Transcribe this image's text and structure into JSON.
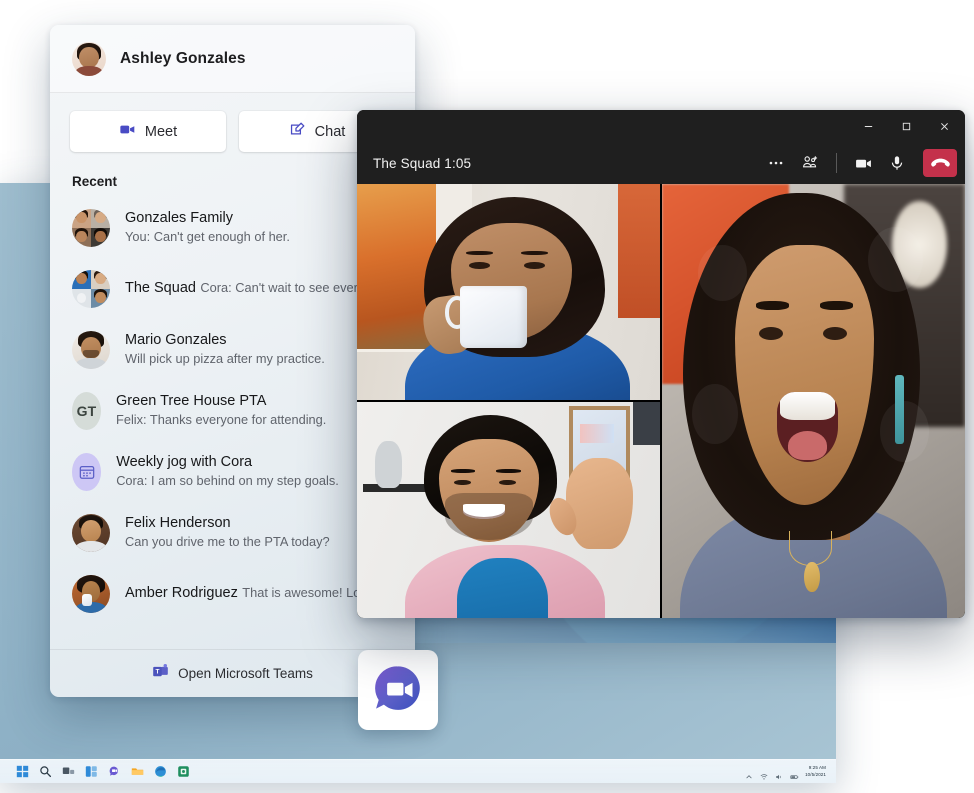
{
  "flyout": {
    "user": {
      "name": "Ashley Gonzales",
      "avatar_icon": "user-avatar-ashley"
    },
    "actions": [
      {
        "id": "meet",
        "label": "Meet",
        "icon": "video-camera-icon"
      },
      {
        "id": "chat",
        "label": "Chat",
        "icon": "compose-chat-icon"
      }
    ],
    "section_title": "Recent",
    "recent": [
      {
        "title": "Gonzales Family",
        "preview": "You: Can't get enough of her.",
        "avatar_type": "group-4",
        "avatar_icon": "group-avatar-gonzales-family"
      },
      {
        "title": "The Squad",
        "preview": "Cora: Can't wait to see everyone!",
        "avatar_type": "group-4",
        "avatar_icon": "group-avatar-the-squad"
      },
      {
        "title": "Mario Gonzales",
        "preview": "Will pick up pizza after my practice.",
        "avatar_type": "photo",
        "avatar_icon": "user-avatar-mario"
      },
      {
        "title": "Green Tree House PTA",
        "preview": "Felix: Thanks everyone for attending.",
        "avatar_type": "initials",
        "initials": "GT",
        "avatar_icon": "initials-avatar-gt"
      },
      {
        "title": "Weekly jog with Cora",
        "preview": "Cora: I am so behind on my step goals.",
        "avatar_type": "icon",
        "avatar_icon": "calendar-icon"
      },
      {
        "title": "Felix Henderson",
        "preview": "Can you drive me to the PTA today?",
        "avatar_type": "photo",
        "avatar_icon": "user-avatar-felix"
      },
      {
        "title": "Amber Rodriguez",
        "preview": "That is awesome! Love it!",
        "avatar_type": "photo",
        "avatar_icon": "user-avatar-amber"
      }
    ],
    "footer": {
      "label": "Open Microsoft Teams",
      "icon": "microsoft-teams-logo-icon"
    }
  },
  "call_window": {
    "title": "The Squad 1:05",
    "window_controls": [
      {
        "id": "minimize",
        "icon": "minimize-icon"
      },
      {
        "id": "maximize",
        "icon": "maximize-icon"
      },
      {
        "id": "close",
        "icon": "close-icon"
      }
    ],
    "tools": [
      {
        "id": "more",
        "icon": "more-options-icon",
        "label": "..."
      },
      {
        "id": "add-people",
        "icon": "add-people-icon",
        "label": ""
      },
      {
        "id": "camera",
        "icon": "video-camera-icon",
        "label": ""
      },
      {
        "id": "microphone",
        "icon": "microphone-icon",
        "label": ""
      },
      {
        "id": "hangup",
        "icon": "hangup-phone-icon",
        "label": ""
      }
    ],
    "hangup_color": "#c4314b",
    "participants": [
      {
        "id": "p1",
        "position": "top-left",
        "description": "woman drinking from mug"
      },
      {
        "id": "p2",
        "position": "bottom-left",
        "description": "man waving"
      },
      {
        "id": "p3",
        "position": "right",
        "description": "woman laughing"
      }
    ]
  },
  "taskbar": {
    "items": [
      {
        "id": "start",
        "icon": "windows-start-icon"
      },
      {
        "id": "search",
        "icon": "search-icon"
      },
      {
        "id": "task-view",
        "icon": "task-view-icon"
      },
      {
        "id": "widgets",
        "icon": "widgets-icon"
      },
      {
        "id": "chat",
        "icon": "teams-chat-icon"
      },
      {
        "id": "file-explorer",
        "icon": "file-explorer-icon"
      },
      {
        "id": "edge",
        "icon": "microsoft-edge-icon"
      },
      {
        "id": "store",
        "icon": "microsoft-store-icon"
      }
    ],
    "tray": [
      {
        "id": "show-hidden",
        "icon": "chevron-up-icon"
      },
      {
        "id": "network",
        "icon": "wifi-icon"
      },
      {
        "id": "volume",
        "icon": "volume-icon"
      },
      {
        "id": "battery",
        "icon": "battery-icon"
      }
    ],
    "clock": {
      "time": "9:25 AM",
      "date": "10/5/2021"
    }
  },
  "teams_chip": {
    "icon": "teams-chat-bubble-icon"
  },
  "colors": {
    "teams_purple": "#5b5fc7",
    "hangup_red": "#c4314b",
    "titlebar_dark": "#1f1f1f",
    "panel_bg": "#eef2f5"
  }
}
